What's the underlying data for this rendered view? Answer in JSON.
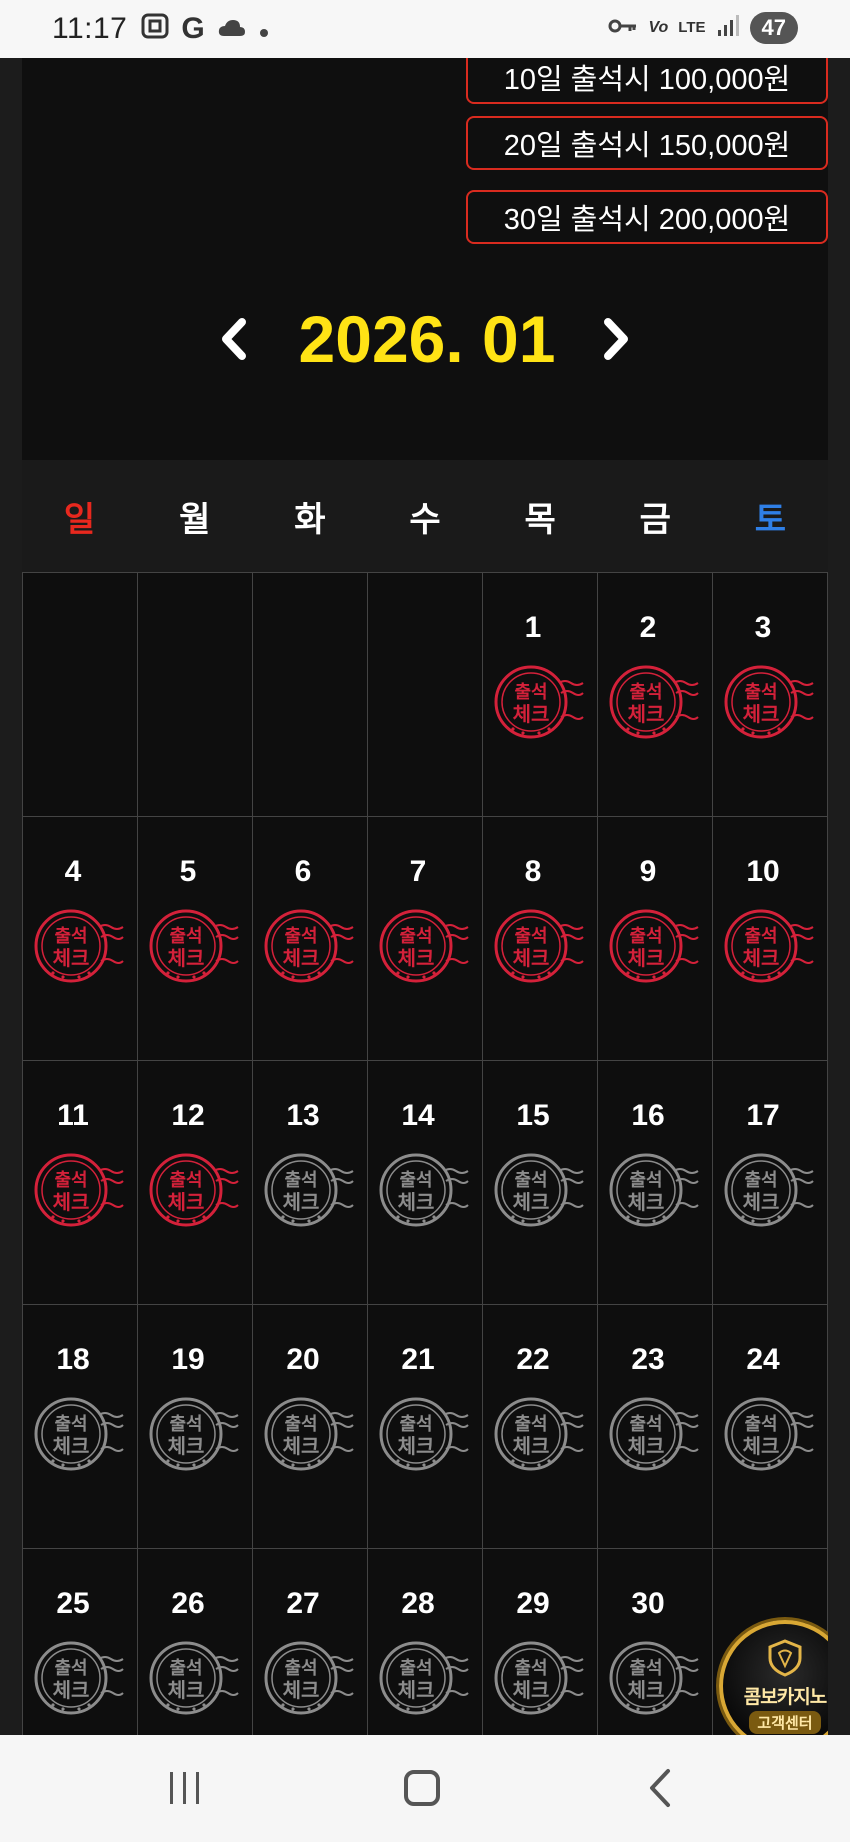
{
  "status_bar": {
    "time": "11:17",
    "battery": "47",
    "network": "LTE",
    "icons": [
      "screenshot-icon",
      "google-icon",
      "cloud-icon",
      "dot-icon",
      "key-icon",
      "volte-icon",
      "lte-icon",
      "signal-icon",
      "battery-icon"
    ]
  },
  "rewards": [
    {
      "label": "10일 출석시 100,000원"
    },
    {
      "label": "20일 출석시 150,000원"
    },
    {
      "label": "30일 출석시 200,000원"
    }
  ],
  "calendar": {
    "month_label": "2026. 01",
    "prev_symbol": "‹",
    "next_symbol": "›",
    "weekdays": [
      "일",
      "월",
      "화",
      "수",
      "목",
      "금",
      "토"
    ],
    "leading_blanks": 4,
    "days": [
      {
        "day": "1",
        "checked": true
      },
      {
        "day": "2",
        "checked": true
      },
      {
        "day": "3",
        "checked": true
      },
      {
        "day": "4",
        "checked": true
      },
      {
        "day": "5",
        "checked": true
      },
      {
        "day": "6",
        "checked": true
      },
      {
        "day": "7",
        "checked": true
      },
      {
        "day": "8",
        "checked": true
      },
      {
        "day": "9",
        "checked": true
      },
      {
        "day": "10",
        "checked": true
      },
      {
        "day": "11",
        "checked": true
      },
      {
        "day": "12",
        "checked": true
      },
      {
        "day": "13",
        "checked": false
      },
      {
        "day": "14",
        "checked": false
      },
      {
        "day": "15",
        "checked": false
      },
      {
        "day": "16",
        "checked": false
      },
      {
        "day": "17",
        "checked": false
      },
      {
        "day": "18",
        "checked": false
      },
      {
        "day": "19",
        "checked": false
      },
      {
        "day": "20",
        "checked": false
      },
      {
        "day": "21",
        "checked": false
      },
      {
        "day": "22",
        "checked": false
      },
      {
        "day": "23",
        "checked": false
      },
      {
        "day": "24",
        "checked": false
      },
      {
        "day": "25",
        "checked": false
      },
      {
        "day": "26",
        "checked": false
      },
      {
        "day": "27",
        "checked": false
      },
      {
        "day": "28",
        "checked": false
      },
      {
        "day": "29",
        "checked": false
      },
      {
        "day": "30",
        "checked": false
      },
      {
        "day": "",
        "checked": false
      }
    ],
    "stamp_text_line1": "출석",
    "stamp_text_line2": "체크",
    "colors": {
      "checked": "#d4213a",
      "unchecked": "#8c8c8c",
      "month": "#ffe315",
      "sunday": "#e8281e",
      "saturday": "#2f7fe6",
      "reward_border": "#d92b1f"
    }
  },
  "customer_center": {
    "brand": "콤보카지노",
    "sub": "고객센터"
  },
  "android_nav": {
    "back_symbol": "‹"
  }
}
